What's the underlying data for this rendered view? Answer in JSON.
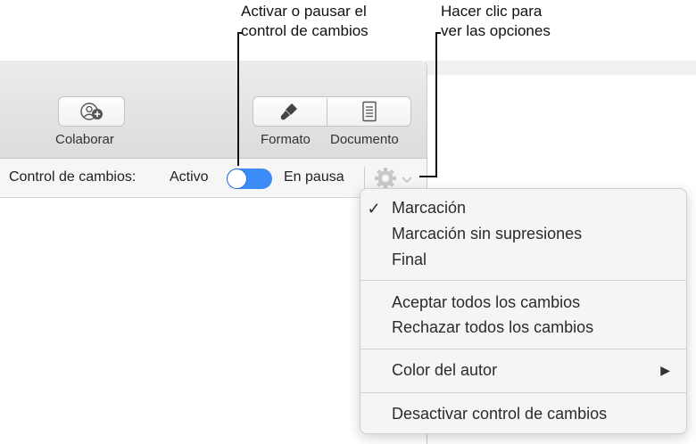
{
  "callouts": {
    "toggle_line1": "Activar o pausar el",
    "toggle_line2": "control de cambios",
    "options_line1": "Hacer clic para",
    "options_line2": "ver las opciones"
  },
  "toolbar": {
    "collaborate_label": "Colaborar",
    "format_label": "Formato",
    "document_label": "Documento"
  },
  "tracking_bar": {
    "label": "Control de cambios:",
    "active_label": "Activo",
    "paused_label": "En pausa",
    "toggle_state": "active"
  },
  "menu": {
    "checked_mark": "✓",
    "markup": "Marcación",
    "markup_no_deletions": "Marcación sin supresiones",
    "final": "Final",
    "accept_all": "Aceptar todos los cambios",
    "reject_all": "Rechazar todos los cambios",
    "author_color": "Color del autor",
    "submenu_arrow": "▶",
    "turn_off": "Desactivar control de cambios"
  },
  "colors": {
    "accent": "#3b8cf7",
    "toolbar_bg": "#e4e4e4",
    "menu_bg": "#f5f5f5"
  }
}
